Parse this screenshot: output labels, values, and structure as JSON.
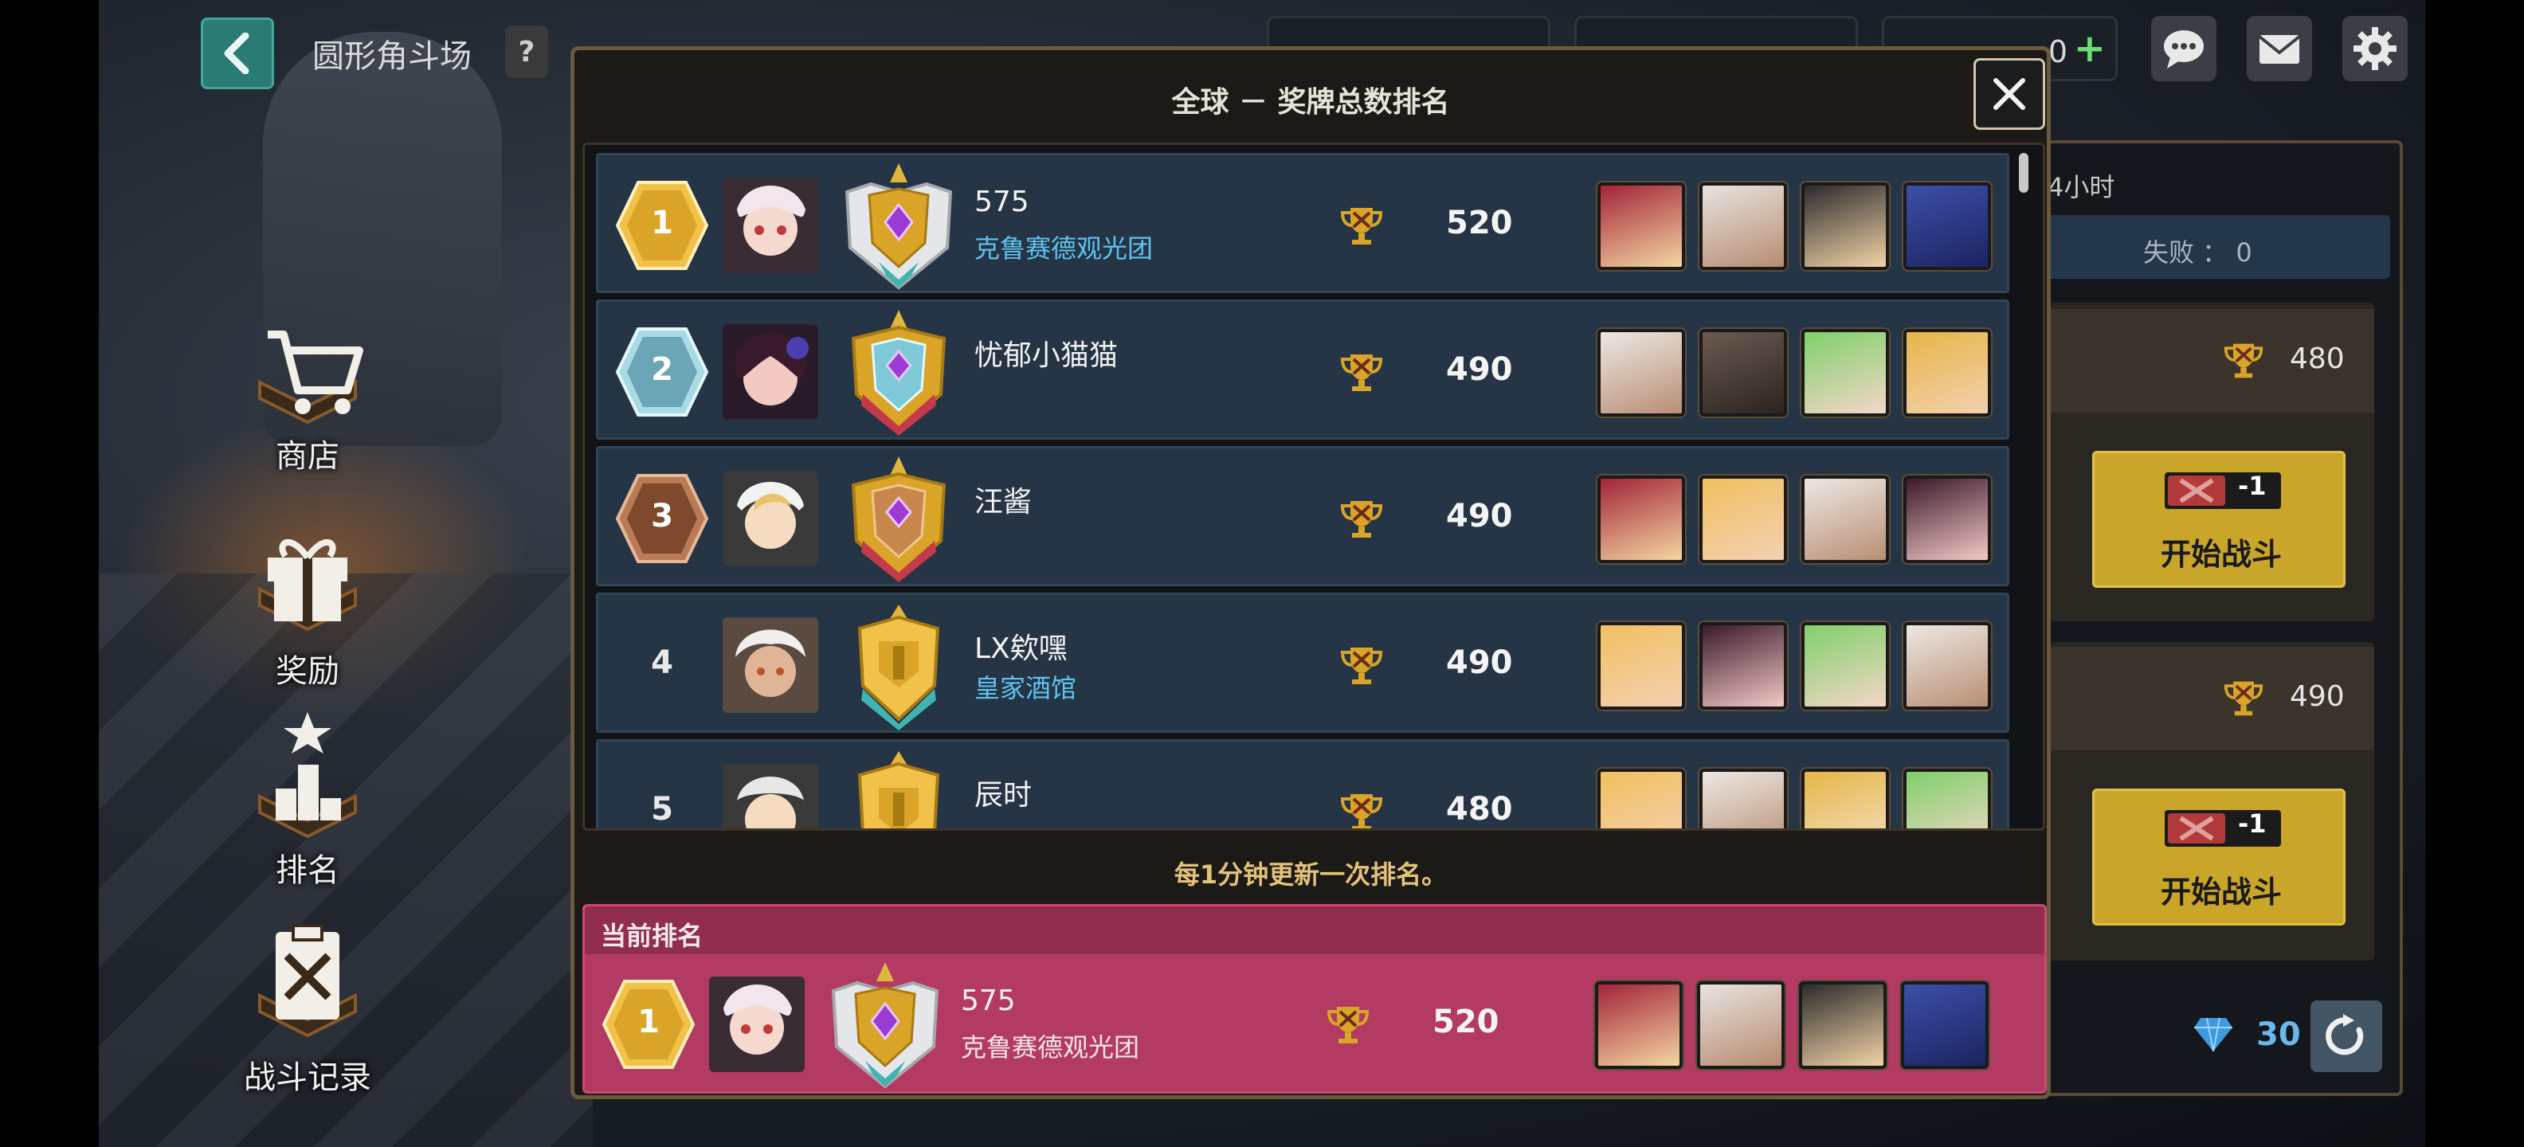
{
  "header": {
    "title": "圆形角斗场",
    "help_label": "?",
    "resource_text": "0",
    "resource_plus": "+"
  },
  "menu": {
    "items": [
      {
        "label": "商店",
        "icon": "cart-icon"
      },
      {
        "label": "奖励",
        "icon": "gift-icon"
      },
      {
        "label": "排名",
        "icon": "podium-icon"
      },
      {
        "label": "战斗记录",
        "icon": "battle-log-icon"
      }
    ]
  },
  "side": {
    "hours_text": "4小时",
    "loss_label": "失败 ：  0",
    "opponents": [
      {
        "score": "480",
        "cost": "-1",
        "button": "开始战斗"
      },
      {
        "score": "490",
        "cost": "-1",
        "button": "开始战斗"
      }
    ],
    "gems": "30"
  },
  "modal": {
    "title": "全球 － 奖牌总数排名",
    "close_label": "×",
    "update_note": "每1分钟更新一次排名。",
    "current_label": "当前排名",
    "rows": [
      {
        "rank": "1",
        "name": "575",
        "guild": "克鲁赛德观光团",
        "score": "520"
      },
      {
        "rank": "2",
        "name": "忧郁小猫猫",
        "guild": "",
        "score": "490"
      },
      {
        "rank": "3",
        "name": "汪酱",
        "guild": "",
        "score": "490"
      },
      {
        "rank": "4",
        "name": "LX欸嘿",
        "guild": "皇家酒馆",
        "score": "490"
      },
      {
        "rank": "5",
        "name": "辰时",
        "guild": "",
        "score": "480"
      }
    ],
    "current": {
      "rank": "1",
      "name": "575",
      "guild": "克鲁赛德观光团",
      "score": "520"
    }
  },
  "colors": {
    "row_bg": "#263545",
    "guild_text": "#5ec3f0",
    "current_bg": "#b33b63",
    "gold": "#d9a427",
    "silver": "#7fb6c4",
    "bronze": "#8a5232"
  }
}
